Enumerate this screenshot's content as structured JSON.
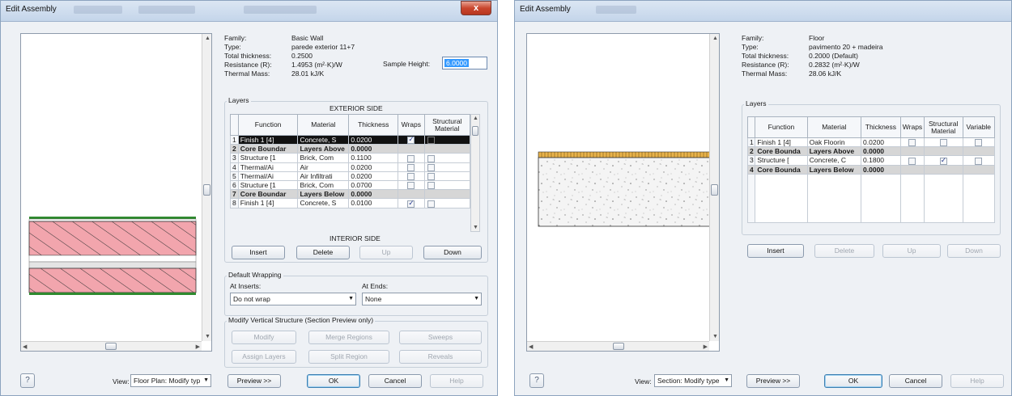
{
  "left_dialog": {
    "title": "Edit Assembly",
    "close_label": "x",
    "properties": [
      {
        "label": "Family:",
        "value": "Basic Wall"
      },
      {
        "label": "Type:",
        "value": "parede exterior 11+7"
      },
      {
        "label": "Total thickness:",
        "value": "0.2500"
      },
      {
        "label": "Resistance (R):",
        "value": "1.4953 (m²·K)/W"
      },
      {
        "label": "Thermal Mass:",
        "value": "28.01 kJ/K"
      }
    ],
    "sample_height_label": "Sample Height:",
    "sample_height_value": "6.0000",
    "layers_label": "Layers",
    "exterior_side_label": "EXTERIOR SIDE",
    "interior_side_label": "INTERIOR SIDE",
    "columns": [
      "Function",
      "Material",
      "Thickness",
      "Wraps",
      "Structural Material"
    ],
    "rows": [
      {
        "num": "1",
        "function": "Finish 1 [4]",
        "material": "Concrete, S",
        "thickness": "0.0200",
        "wraps": true,
        "structural": false
      },
      {
        "num": "2",
        "function": "Core Boundar",
        "material": "Layers Above",
        "thickness": "0.0000"
      },
      {
        "num": "3",
        "function": "Structure [1",
        "material": "Brick, Com",
        "thickness": "0.1100",
        "wraps": false,
        "structural": false
      },
      {
        "num": "4",
        "function": "Thermal/Ai",
        "material": "Air",
        "thickness": "0.0200",
        "wraps": false,
        "structural": false
      },
      {
        "num": "5",
        "function": "Thermal/Ai",
        "material": "Air Infiltrati",
        "thickness": "0.0200",
        "wraps": false,
        "structural": false
      },
      {
        "num": "6",
        "function": "Structure [1",
        "material": "Brick, Com",
        "thickness": "0.0700",
        "wraps": false,
        "structural": false
      },
      {
        "num": "7",
        "function": "Core Boundar",
        "material": "Layers Below",
        "thickness": "0.0000"
      },
      {
        "num": "8",
        "function": "Finish 1 [4]",
        "material": "Concrete, S",
        "thickness": "0.0100",
        "wraps": true,
        "structural": false
      }
    ],
    "buttons": {
      "insert": "Insert",
      "delete": "Delete",
      "up": "Up",
      "down": "Down"
    },
    "default_wrapping_label": "Default Wrapping",
    "at_inserts_label": "At Inserts:",
    "at_inserts_value": "Do not wrap",
    "at_ends_label": "At Ends:",
    "at_ends_value": "None",
    "modify_vertical_label": "Modify Vertical Structure (Section Preview only)",
    "vertical_buttons": {
      "modify": "Modify",
      "merge_regions": "Merge Regions",
      "sweeps": "Sweeps",
      "assign_layers": "Assign Layers",
      "split_region": "Split Region",
      "reveals": "Reveals"
    },
    "view_label": "View:",
    "view_value": "Floor Plan: Modify typ",
    "footer": {
      "preview": "Preview >>",
      "ok": "OK",
      "cancel": "Cancel",
      "help": "Help"
    }
  },
  "right_dialog": {
    "title": "Edit Assembly",
    "properties": [
      {
        "label": "Family:",
        "value": "Floor"
      },
      {
        "label": "Type:",
        "value": "pavimento 20 + madeira"
      },
      {
        "label": "Total thickness:",
        "value": "0.2000 (Default)"
      },
      {
        "label": "Resistance (R):",
        "value": "0.2832 (m²·K)/W"
      },
      {
        "label": "Thermal Mass:",
        "value": "28.06 kJ/K"
      }
    ],
    "layers_label": "Layers",
    "columns": [
      "Function",
      "Material",
      "Thickness",
      "Wraps",
      "Structural Material",
      "Variable"
    ],
    "rows": [
      {
        "num": "1",
        "function": "Finish 1 [4]",
        "material": "Oak Floorin",
        "thickness": "0.0200",
        "wraps": false,
        "structural": false,
        "variable": false
      },
      {
        "num": "2",
        "function": "Core Bounda",
        "material": "Layers Above",
        "thickness": "0.0000"
      },
      {
        "num": "3",
        "function": "Structure [",
        "material": "Concrete, C",
        "thickness": "0.1800",
        "wraps": false,
        "structural": true,
        "variable": false
      },
      {
        "num": "4",
        "function": "Core Bounda",
        "material": "Layers Below",
        "thickness": "0.0000"
      }
    ],
    "buttons": {
      "insert": "Insert",
      "delete": "Delete",
      "up": "Up",
      "down": "Down"
    },
    "view_label": "View:",
    "view_value": "Section: Modify type",
    "footer": {
      "preview": "Preview >>",
      "ok": "OK",
      "cancel": "Cancel",
      "help": "Help"
    }
  },
  "colors": {
    "wall_hatch": "#f2a5ad",
    "wall_edge_green": "#2f8a2f",
    "floor_wood": "#e8b24a",
    "floor_concrete": "#f4f4f4"
  }
}
